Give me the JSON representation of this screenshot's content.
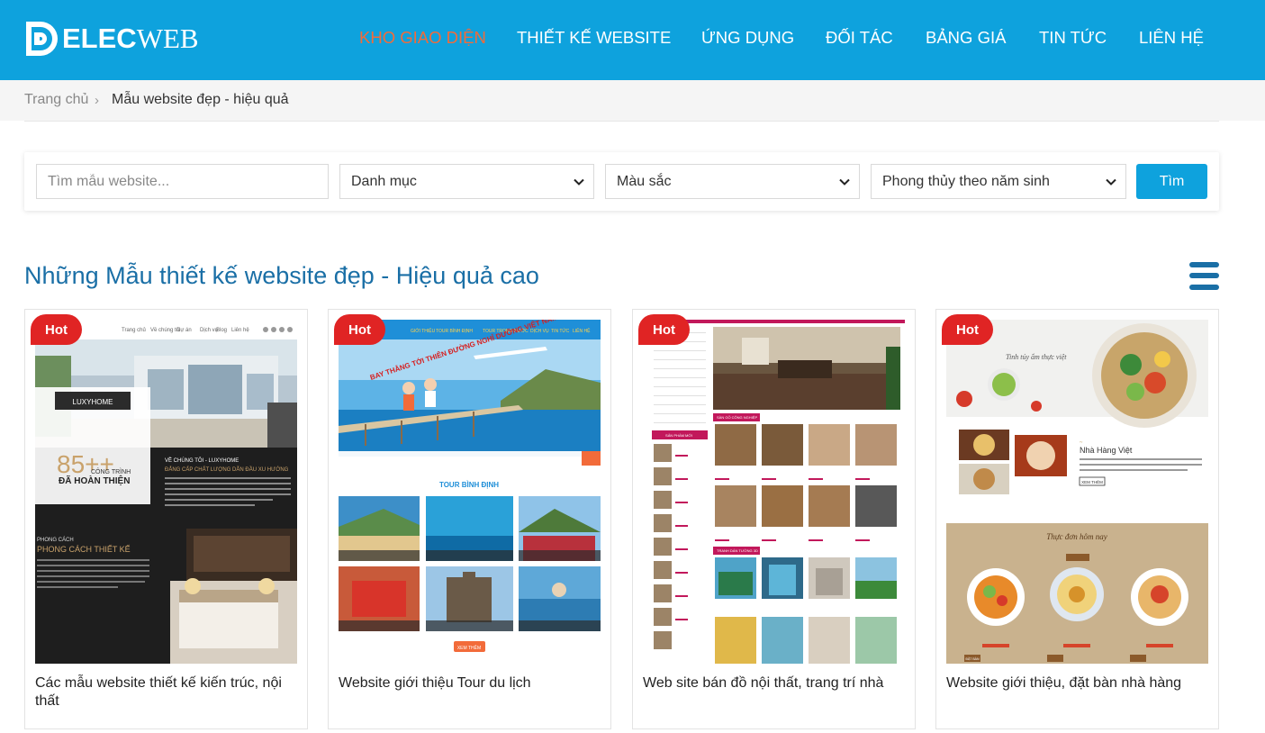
{
  "header": {
    "logo": {
      "bold": "ELEC",
      "thin": "WEB",
      "icon": "delecweb-logo-icon"
    },
    "nav": [
      {
        "label": "KHO GIAO DIỆN",
        "active": true
      },
      {
        "label": "THIẾT KẾ WEBSITE"
      },
      {
        "label": "ỨNG DỤNG"
      },
      {
        "label": "ĐỐI TÁC"
      },
      {
        "label": "BẢNG GIÁ"
      },
      {
        "label": "TIN TỨC"
      },
      {
        "label": "LIÊN HỆ"
      }
    ],
    "bg_color": "#0ea2dd",
    "active_color": "#f26b3a"
  },
  "breadcrumb": {
    "home": "Trang chủ",
    "separator": "›",
    "current": "Mẫu website đẹp - hiệu quả"
  },
  "search": {
    "placeholder": "Tìm mẫu website...",
    "category": "Danh mục",
    "color": "Màu sắc",
    "fengshui": "Phong thủy theo năm sinh",
    "button": "Tìm"
  },
  "section": {
    "title": "Những Mẫu thiết kế website đẹp - Hiệu quả cao",
    "menu_icon": "hamburger-menu-icon"
  },
  "cards": [
    {
      "badge": "Hot",
      "title": "Các mẫu website thiết kế kiến trúc, nội thất"
    },
    {
      "badge": "Hot",
      "title": "Website giới thiệu Tour du lịch"
    },
    {
      "badge": "Hot",
      "title": "Web site bán đồ nội thất, trang trí nhà"
    },
    {
      "badge": "Hot",
      "title": "Website giới thiệu, đặt bàn nhà hàng"
    }
  ],
  "thumbs": {
    "t1": {
      "brand": "LUXYHOME",
      "stat": "85++",
      "stat_label": "CÔNG TRÌNH",
      "stat_sub": "ĐÃ HOÀN THIỆN",
      "about": "VỀ CHÚNG TÔI - LUXYHOME",
      "about_sub": "ĐẲNG CẤP CHẤT LƯỢNG DẪN ĐẦU XU HƯỚNG",
      "style_small": "PHONG CÁCH",
      "style": "PHONG CÁCH THIẾT KẾ"
    },
    "t2": {
      "slogan": "BAY THẲNG TỚI THIÊN ĐƯỜNG NGHỈ DƯỠNG VIỆT NAM",
      "section": "TOUR BÌNH ĐỊNH",
      "more": "XEM THÊM"
    },
    "t3": {
      "cat1": "SÀN GỖ CÔNG NGHIỆP",
      "cat2": "TRANH DÁN TƯỜNG 3D",
      "cat3": "SẢN PHẨM MỚI"
    },
    "t4": {
      "hero": "Tinh túy ẩm thực việt",
      "name": "Nhà Hàng Việt",
      "menu": "Thực đơn hôm nay",
      "more": "XEM THÊM",
      "dish_btn": "ĐẶT BÀN"
    }
  }
}
